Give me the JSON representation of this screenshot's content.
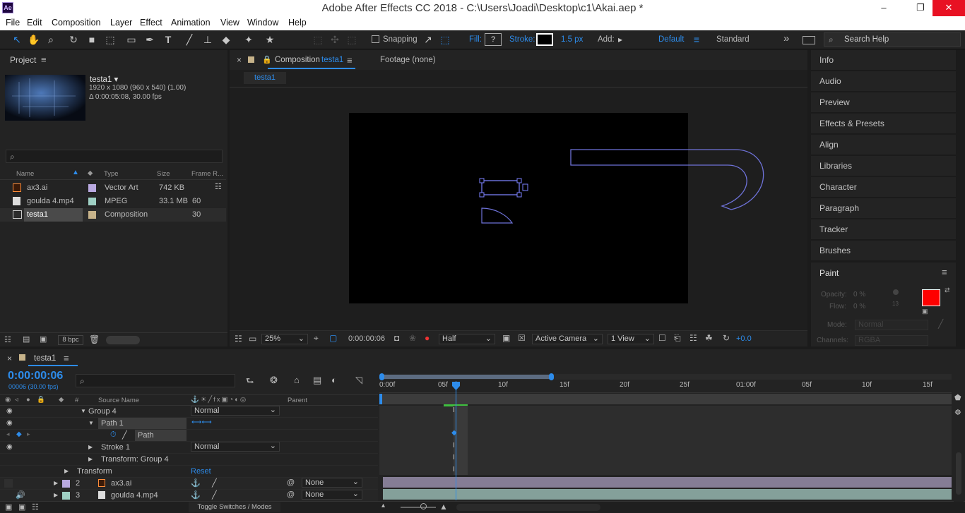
{
  "window": {
    "title": "Adobe After Effects CC 2018 - C:\\Users\\Joadi\\Desktop\\c1\\Akai.aep *",
    "app_icon": "Ae",
    "minimize": "–",
    "restore": "❐",
    "close": "✕"
  },
  "menu": [
    "File",
    "Edit",
    "Composition",
    "Layer",
    "Effect",
    "Animation",
    "View",
    "Window",
    "Help"
  ],
  "toolbar": {
    "snapping": "Snapping",
    "fill_label": "Fill:",
    "fill_value": "?",
    "stroke_label": "Stroke:",
    "stroke_width": "1.5 px",
    "add_label": "Add:",
    "workspace_default": "Default",
    "workspace_standard": "Standard",
    "more": "»",
    "search_help": "Search Help"
  },
  "project": {
    "tab": "Project",
    "item_name": "testa1 ▾",
    "item_res": "1920 x 1080  (960 x 540) (1.00)",
    "item_dur": "Δ 0:00:05:08, 30.00 fps",
    "search_placeholder": "",
    "columns": {
      "name": "Name",
      "type": "Type",
      "size": "Size",
      "frame": "Frame R..."
    },
    "rows": [
      {
        "name": "ax3.ai",
        "type": "Vector Art",
        "size": "742 KB",
        "frame": "",
        "color": "#b9a9e0"
      },
      {
        "name": "goulda 4.mp4",
        "type": "MPEG",
        "size": "33.1 MB",
        "frame": "60",
        "color": "#9fd0c4"
      },
      {
        "name": "testa1",
        "type": "Composition",
        "size": "",
        "frame": "30",
        "color": "#c7b38a"
      }
    ],
    "bpc": "8 bpc"
  },
  "viewer": {
    "tab_close": "×",
    "tab_label": "Composition",
    "tab_comp": "testa1",
    "footage_tab": "Footage  (none)",
    "subtab": "testa1",
    "zoom": "25%",
    "timecode": "0:00:00:06",
    "resolution": "Half",
    "camera": "Active Camera",
    "views": "1 View",
    "exposure": "+0.0"
  },
  "right_panels": [
    "Info",
    "Audio",
    "Preview",
    "Effects & Presets",
    "Align",
    "Libraries",
    "Character",
    "Paragraph",
    "Tracker",
    "Brushes"
  ],
  "paint": {
    "title": "Paint",
    "opacity_label": "Opacity:",
    "opacity_value": "0 %",
    "flow_label": "Flow:",
    "flow_value": "0 %",
    "brush_size": "13",
    "mode_label": "Mode:",
    "mode_value": "Normal",
    "channels_label": "Channels:",
    "channels_value": "RGBA",
    "fg_color": "#ff0000",
    "bg_color": "#ffffff"
  },
  "timeline": {
    "tab_close": "×",
    "tab": "testa1",
    "timecode": "0:00:00:06",
    "frame_info": "00006 (30.00 fps)",
    "col_source": "Source Name",
    "col_parent": "Parent",
    "col_hash": "#",
    "ruler": [
      "0:00f",
      "05f",
      "10f",
      "15f",
      "20f",
      "25f",
      "01:00f",
      "05f",
      "10f",
      "15f"
    ],
    "rows": [
      {
        "label": "Group 4",
        "mode": "Normal"
      },
      {
        "label": "Path 1"
      },
      {
        "label": "Path"
      },
      {
        "label": "Stroke 1",
        "mode": "Normal"
      },
      {
        "label": "Transform: Group 4"
      },
      {
        "label": "Transform",
        "reset": "Reset"
      },
      {
        "num": "2",
        "label": "ax3.ai",
        "parent": "None",
        "color": "#b9a9e0"
      },
      {
        "num": "3",
        "label": "goulda 4.mp4",
        "parent": "None",
        "color": "#9fd0c4"
      }
    ],
    "toggle": "Toggle Switches / Modes"
  }
}
